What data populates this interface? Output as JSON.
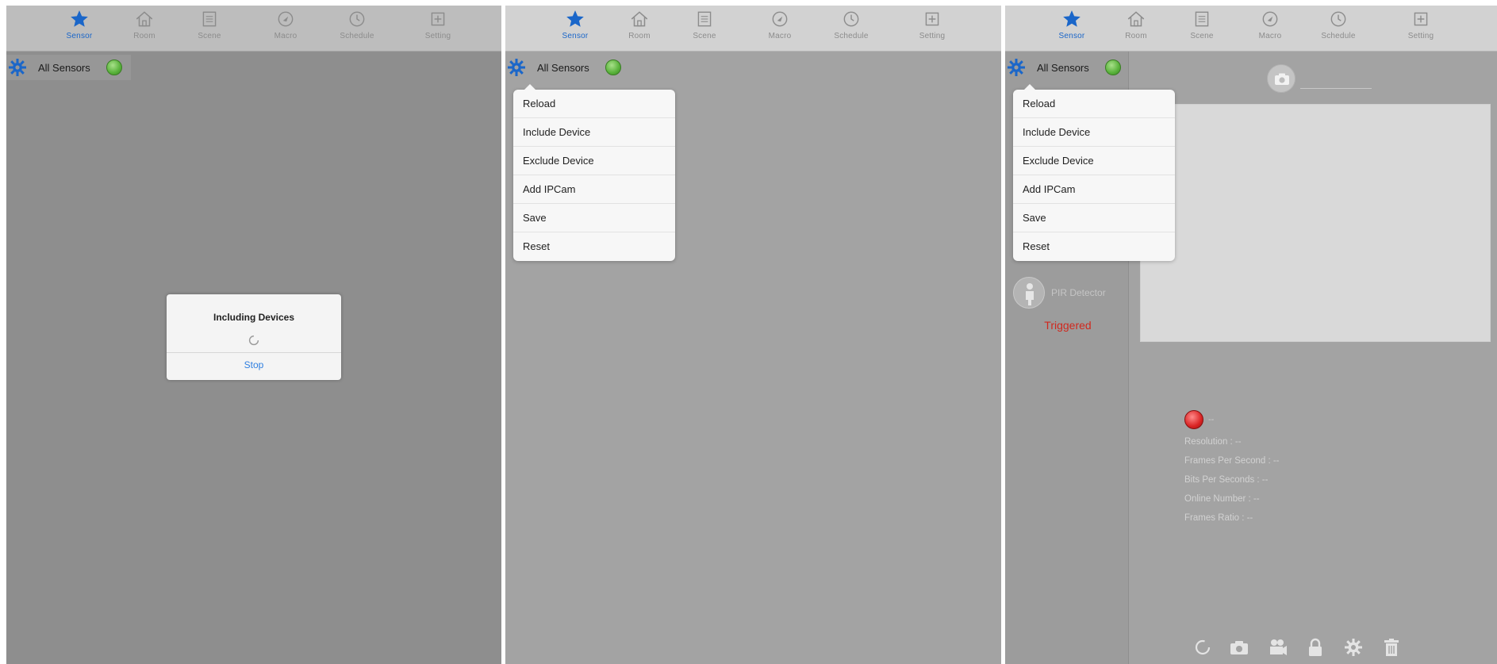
{
  "tabs": [
    {
      "label": "Sensor",
      "icon": "star-icon",
      "active": true
    },
    {
      "label": "Room",
      "icon": "house-icon"
    },
    {
      "label": "Scene",
      "icon": "scene-icon"
    },
    {
      "label": "Macro",
      "icon": "macro-icon"
    },
    {
      "label": "Schedule",
      "icon": "schedule-icon"
    },
    {
      "label": "Setting",
      "icon": "setting-icon"
    }
  ],
  "header": {
    "title": "All Sensors"
  },
  "dialog": {
    "title": "Including Devices",
    "button": "Stop"
  },
  "menu": {
    "items": [
      "Reload",
      "Include Device",
      "Exclude Device",
      "Add IPCam",
      "Save",
      "Reset"
    ]
  },
  "sensor": {
    "name": "PIR Detector",
    "state": "Triggered"
  },
  "camera": {
    "status": "--",
    "lines": [
      "Resolution : --",
      "Frames Per Second : --",
      "Bits Per Seconds : --",
      "Online Number : --",
      "Frames Ratio : --"
    ]
  },
  "toolbar": {
    "icons": [
      "refresh-icon",
      "camera-icon",
      "video-icon",
      "lock-icon",
      "gear-icon",
      "trash-icon"
    ]
  },
  "colors": {
    "accent": "#1a66c9",
    "status_ok": "#58b13a",
    "alert": "#d0281e",
    "link": "#2f7fe0"
  }
}
